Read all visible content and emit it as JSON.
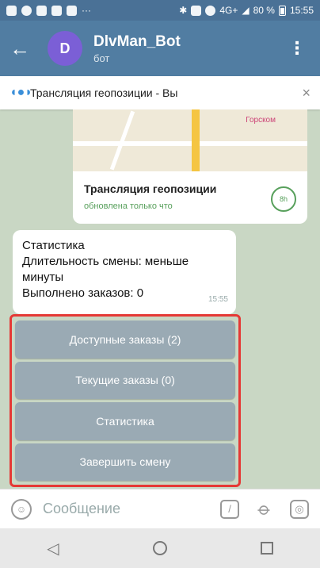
{
  "status_bar": {
    "network": "4G+",
    "battery": "80 %",
    "time": "15:55"
  },
  "header": {
    "back_icon": "←",
    "avatar_letter": "D",
    "bot_name": "DlvMan_Bot",
    "subtitle": "бот",
    "menu_icon": "⋮"
  },
  "live_location_bar": {
    "text": "Трансляция геопозиции - Вы",
    "close_icon": "×"
  },
  "map_message": {
    "map_label": "Горском",
    "title": "Трансляция геопозиции",
    "status": "обновлена только что",
    "timer": "8h"
  },
  "stats_message": {
    "line1": "Статистика",
    "line2": "Длительность смены: меньше минуты",
    "line3": "Выполнено заказов: 0",
    "time": "15:55"
  },
  "keyboard": {
    "buttons": [
      "Доступные заказы (2)",
      "Текущие заказы (0)",
      "Статистика",
      "Завершить смену"
    ]
  },
  "input": {
    "placeholder": "Сообщение",
    "emoji_icon": "☺",
    "command_icon": "/",
    "attach_icon": "📎",
    "camera_icon": "◎"
  },
  "nav": {
    "back": "◁"
  }
}
